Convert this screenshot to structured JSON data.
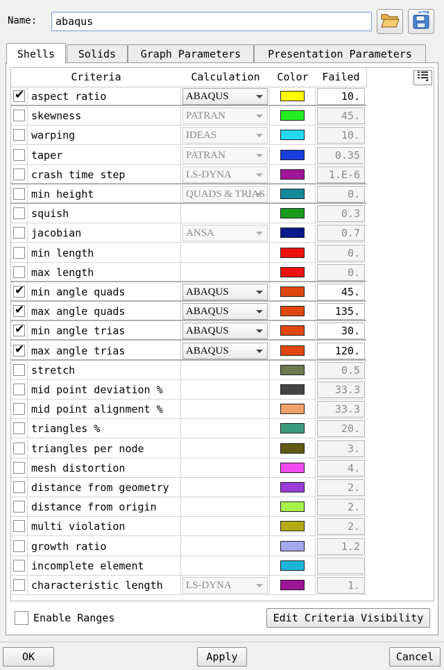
{
  "name": {
    "label": "Name:",
    "value": "abaqus"
  },
  "icons": {
    "open": "folder-open-icon",
    "save": "save-icon",
    "columns": "column-config-icon"
  },
  "tabs": [
    {
      "label": "Shells",
      "active": true
    },
    {
      "label": "Solids",
      "active": false
    },
    {
      "label": "Graph Parameters",
      "active": false
    },
    {
      "label": "Presentation Parameters",
      "active": false
    }
  ],
  "table": {
    "headers": {
      "criteria": "Criteria",
      "calculation": "Calculation",
      "color": "Color",
      "failed": "Failed"
    },
    "rows": [
      {
        "checked": true,
        "criteria": "aspect ratio",
        "calc": "ABAQUS",
        "calc_enabled": true,
        "color": "#ffff00",
        "failed": "10.",
        "failed_enabled": true,
        "sep": true
      },
      {
        "checked": false,
        "criteria": "skewness",
        "calc": "PATRAN",
        "calc_enabled": false,
        "color": "#22ee22",
        "failed": "45.",
        "failed_enabled": false,
        "sep": false
      },
      {
        "checked": false,
        "criteria": "warping",
        "calc": "IDEAS",
        "calc_enabled": false,
        "color": "#22d8ee",
        "failed": "10.",
        "failed_enabled": false,
        "sep": false
      },
      {
        "checked": false,
        "criteria": "taper",
        "calc": "PATRAN",
        "calc_enabled": false,
        "color": "#1a3fdc",
        "failed": "0.35",
        "failed_enabled": false,
        "sep": false
      },
      {
        "checked": false,
        "criteria": "crash time step",
        "calc": "LS-DYNA",
        "calc_enabled": false,
        "color": "#a0149a",
        "failed": "1.E-6",
        "failed_enabled": false,
        "sep": true
      },
      {
        "checked": false,
        "criteria": "min height",
        "calc": "QUADS & TRIAS",
        "calc_enabled": false,
        "color": "#14899a",
        "failed": "0.",
        "failed_enabled": false,
        "sep": true
      },
      {
        "checked": false,
        "criteria": "squish",
        "calc": "",
        "calc_enabled": false,
        "color": "#179a1c",
        "failed": "0.3",
        "failed_enabled": false,
        "sep": false
      },
      {
        "checked": false,
        "criteria": "jacobian",
        "calc": "ANSA",
        "calc_enabled": false,
        "color": "#0b1a8a",
        "failed": "0.7",
        "failed_enabled": false,
        "sep": false
      },
      {
        "checked": false,
        "criteria": "min length",
        "calc": "",
        "calc_enabled": false,
        "color": "#ee1111",
        "failed": "0.",
        "failed_enabled": false,
        "sep": false
      },
      {
        "checked": false,
        "criteria": "max length",
        "calc": "",
        "calc_enabled": false,
        "color": "#ee1111",
        "failed": "0.",
        "failed_enabled": false,
        "sep": true
      },
      {
        "checked": true,
        "criteria": "min angle quads",
        "calc": "ABAQUS",
        "calc_enabled": true,
        "color": "#e0470f",
        "failed": "45.",
        "failed_enabled": true,
        "sep": true
      },
      {
        "checked": true,
        "criteria": "max angle quads",
        "calc": "ABAQUS",
        "calc_enabled": true,
        "color": "#e0470f",
        "failed": "135.",
        "failed_enabled": true,
        "sep": true
      },
      {
        "checked": true,
        "criteria": "min angle trias",
        "calc": "ABAQUS",
        "calc_enabled": true,
        "color": "#e0470f",
        "failed": "30.",
        "failed_enabled": true,
        "sep": true
      },
      {
        "checked": true,
        "criteria": "max angle trias",
        "calc": "ABAQUS",
        "calc_enabled": true,
        "color": "#e0470f",
        "failed": "120.",
        "failed_enabled": true,
        "sep": true
      },
      {
        "checked": false,
        "criteria": "stretch",
        "calc": "",
        "calc_enabled": false,
        "color": "#6c7a4e",
        "failed": "0.5",
        "failed_enabled": false,
        "sep": false
      },
      {
        "checked": false,
        "criteria": "mid point deviation %",
        "calc": "",
        "calc_enabled": false,
        "color": "#454545",
        "failed": "33.3",
        "failed_enabled": false,
        "sep": false
      },
      {
        "checked": false,
        "criteria": "mid point alignment %",
        "calc": "",
        "calc_enabled": false,
        "color": "#f2a06a",
        "failed": "33.3",
        "failed_enabled": false,
        "sep": false
      },
      {
        "checked": false,
        "criteria": "triangles %",
        "calc": "",
        "calc_enabled": false,
        "color": "#3c9a7c",
        "failed": "20.",
        "failed_enabled": false,
        "sep": false
      },
      {
        "checked": false,
        "criteria": "triangles per node",
        "calc": "",
        "calc_enabled": false,
        "color": "#605a12",
        "failed": "3.",
        "failed_enabled": false,
        "sep": false
      },
      {
        "checked": false,
        "criteria": "mesh distortion",
        "calc": "",
        "calc_enabled": false,
        "color": "#f04cf0",
        "failed": "4.",
        "failed_enabled": false,
        "sep": false
      },
      {
        "checked": false,
        "criteria": "distance from geometry",
        "calc": "",
        "calc_enabled": false,
        "color": "#9a3ad8",
        "failed": "2.",
        "failed_enabled": false,
        "sep": false
      },
      {
        "checked": false,
        "criteria": "distance from origin",
        "calc": "",
        "calc_enabled": false,
        "color": "#a8f04a",
        "failed": "2.",
        "failed_enabled": false,
        "sep": false
      },
      {
        "checked": false,
        "criteria": "multi violation",
        "calc": "",
        "calc_enabled": false,
        "color": "#b4aa14",
        "failed": "2.",
        "failed_enabled": false,
        "sep": false
      },
      {
        "checked": false,
        "criteria": "growth ratio",
        "calc": "",
        "calc_enabled": false,
        "color": "#a4a8ec",
        "failed": "1.2",
        "failed_enabled": false,
        "sep": false
      },
      {
        "checked": false,
        "criteria": "incomplete element",
        "calc": "",
        "calc_enabled": false,
        "color": "#1ab4d8",
        "failed": "",
        "failed_enabled": false,
        "sep": false
      },
      {
        "checked": false,
        "criteria": "characteristic length",
        "calc": "LS-DYNA",
        "calc_enabled": false,
        "color": "#a0149a",
        "failed": "1.",
        "failed_enabled": false,
        "sep": false
      }
    ]
  },
  "enable_ranges": {
    "label": "Enable Ranges",
    "checked": false
  },
  "buttons": {
    "edit_visibility": "Edit Criteria Visibility",
    "ok": "OK",
    "apply": "Apply",
    "cancel": "Cancel"
  }
}
